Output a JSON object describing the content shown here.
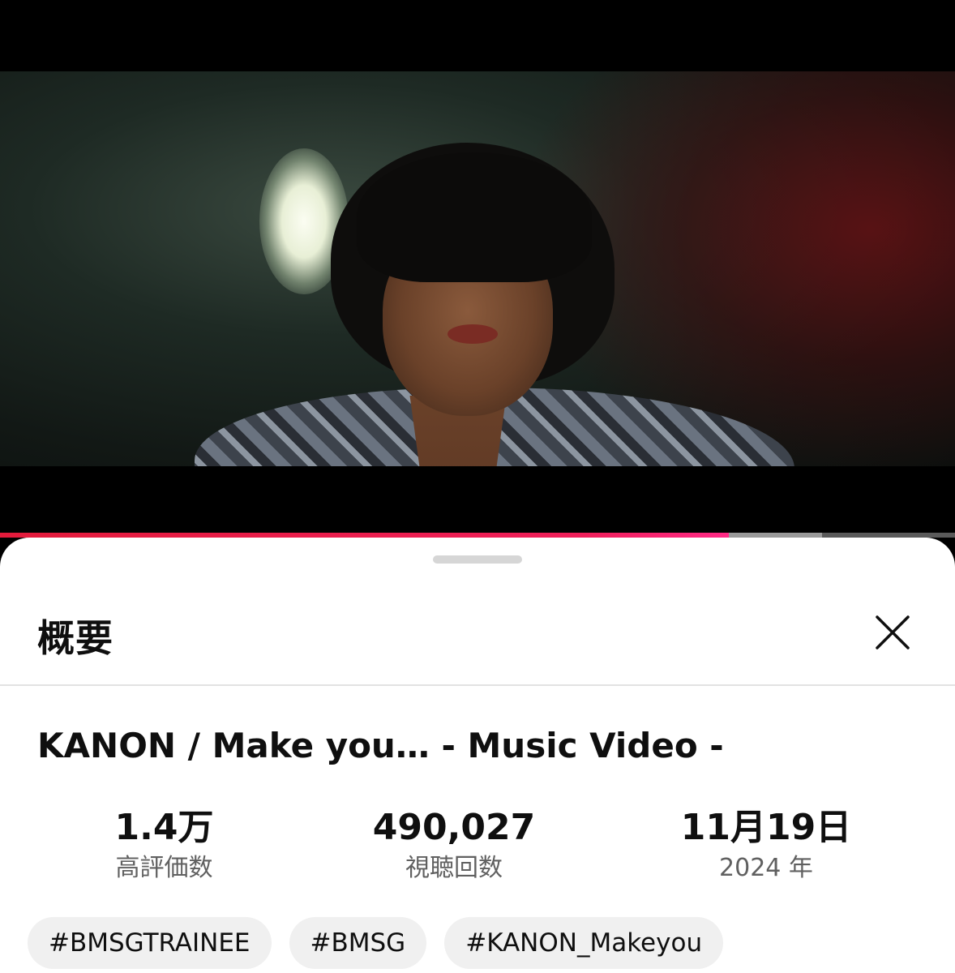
{
  "player": {
    "progress_fraction": 0.763,
    "buffered_fraction": 0.861,
    "colors": {
      "progress_start": "#e31b3b",
      "progress_end": "#ff2a86",
      "buffer": "#9a9a9a",
      "track": "#5a5a5a"
    }
  },
  "sheet": {
    "title": "概要",
    "close_icon": "close-icon",
    "video_title": "KANON / Make you… - Music Video -",
    "stats": [
      {
        "value": "1.4万",
        "label": "高評価数"
      },
      {
        "value": "490,027",
        "label": "視聴回数"
      },
      {
        "value": "11月19日",
        "label": "2024 年"
      }
    ],
    "tags": [
      "#BMSGTRAINEE",
      "#BMSG",
      "#KANON_Makeyou"
    ]
  }
}
